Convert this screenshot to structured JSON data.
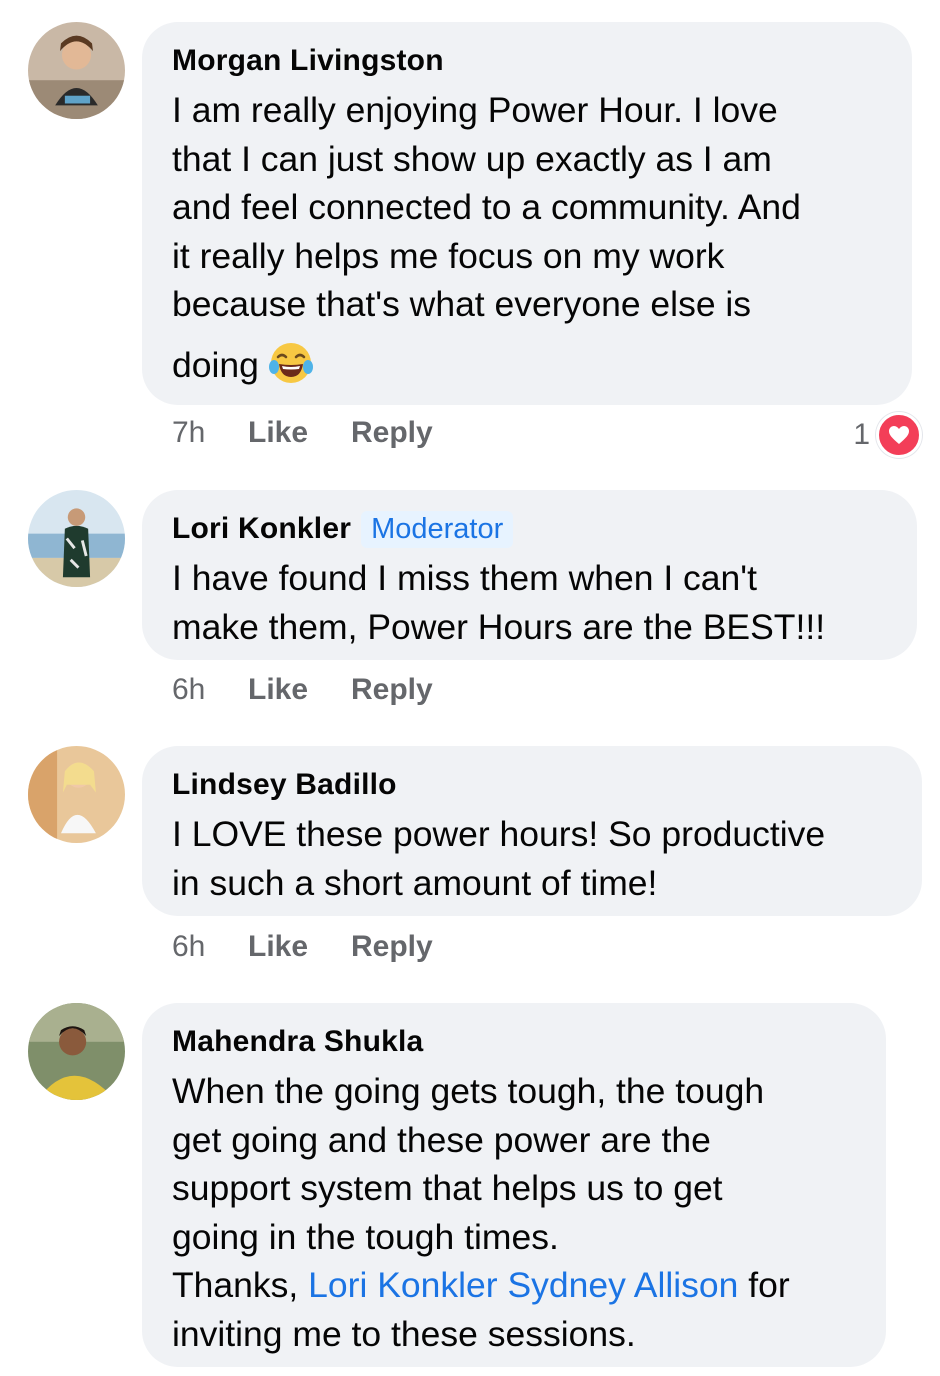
{
  "comments": [
    {
      "author": "Morgan Livingston",
      "badge": "",
      "text_lines": [
        "I am really enjoying Power Hour. I love",
        "that I can just show up exactly as I am",
        "and feel connected to a community. And",
        "it really helps me focus on my work",
        "because that's what everyone else is",
        "doing"
      ],
      "emoji": "tears-of-joy-emoji",
      "time": "7h",
      "like_label": "Like",
      "reply_label": "Reply",
      "reaction_count": "1",
      "reaction_icon": "heart-icon",
      "reaction_color": "#f33e58"
    },
    {
      "author": "Lori Konkler",
      "badge": "Moderator",
      "text_lines": [
        "I have found I miss them when I can't",
        "make them, Power Hours are the BEST!!!"
      ],
      "time": "6h",
      "like_label": "Like",
      "reply_label": "Reply"
    },
    {
      "author": "Lindsey Badillo",
      "badge": "",
      "text_lines": [
        "I LOVE these power hours! So productive",
        "in such a short amount of time!"
      ],
      "time": "6h",
      "like_label": "Like",
      "reply_label": "Reply"
    },
    {
      "author": "Mahendra Shukla",
      "badge": "",
      "text_lines": [
        "When the going gets tough, the tough",
        "get going and these power are the",
        "support system that helps us to get",
        "going in the tough times."
      ],
      "thanks_prefix": "Thanks, ",
      "mention_1": "Lori Konkler",
      "mention_sep": " ",
      "mention_2": "Sydney Allison",
      "thanks_suffix": " for",
      "last_line": "inviting me to these sessions."
    }
  ],
  "colors": {
    "bubble": "#f0f2f5",
    "link": "#1b74e4",
    "meta": "#65676b",
    "badge_bg": "#e7f3ff"
  }
}
